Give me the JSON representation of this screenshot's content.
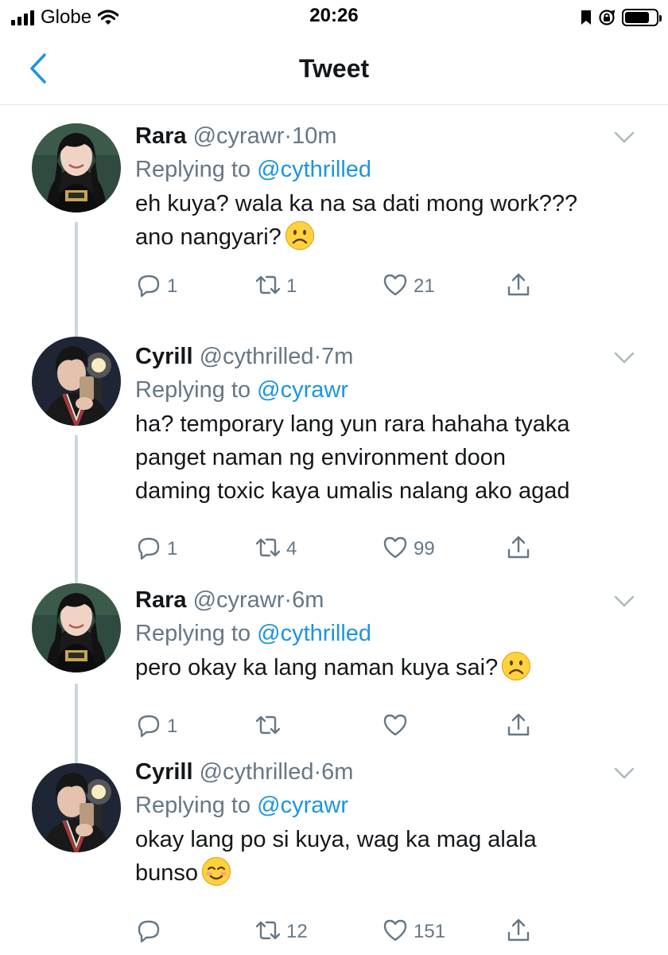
{
  "status_bar": {
    "carrier": "Globe",
    "time": "20:26",
    "battery_level": 0.78
  },
  "header": {
    "title": "Tweet",
    "back_icon": "chevron-left-icon"
  },
  "colors": {
    "link": "#1b95e0",
    "secondary_text": "#657786",
    "divider": "#e1e8ed",
    "thread_line": "#ccd6dd"
  },
  "tweets": [
    {
      "name": "Rara",
      "handle": "@cyrawr",
      "separator": "·",
      "time": "10m",
      "replying_prefix": "Replying to",
      "replying_to": "@cythrilled",
      "lines": [
        "eh kuya? wala ka na sa dati mong work???",
        "ano nangyari?"
      ],
      "emoji": "frowning-face",
      "reply_count": "1",
      "retweet_count": "1",
      "like_count": "21"
    },
    {
      "name": "Cyrill",
      "handle": "@cythrilled",
      "separator": "·",
      "time": "7m",
      "replying_prefix": "Replying to",
      "replying_to": "@cyrawr",
      "lines": [
        "ha? temporary lang yun rara hahaha tyaka",
        "panget naman ng environment doon",
        "daming toxic kaya umalis nalang ako agad"
      ],
      "emoji": "",
      "reply_count": "1",
      "retweet_count": "4",
      "like_count": "99"
    },
    {
      "name": "Rara",
      "handle": "@cyrawr",
      "separator": "·",
      "time": "6m",
      "replying_prefix": "Replying to",
      "replying_to": "@cythrilled",
      "lines": [
        "pero okay ka lang naman kuya sai?"
      ],
      "emoji": "frowning-face",
      "reply_count": "1",
      "retweet_count": "",
      "like_count": ""
    },
    {
      "name": "Cyrill",
      "handle": "@cythrilled",
      "separator": "·",
      "time": "6m",
      "replying_prefix": "Replying to",
      "replying_to": "@cyrawr",
      "lines": [
        "okay lang po si kuya, wag ka mag alala",
        "bunso"
      ],
      "emoji": "smiling-face",
      "reply_count": "",
      "retweet_count": "12",
      "like_count": "151"
    }
  ]
}
